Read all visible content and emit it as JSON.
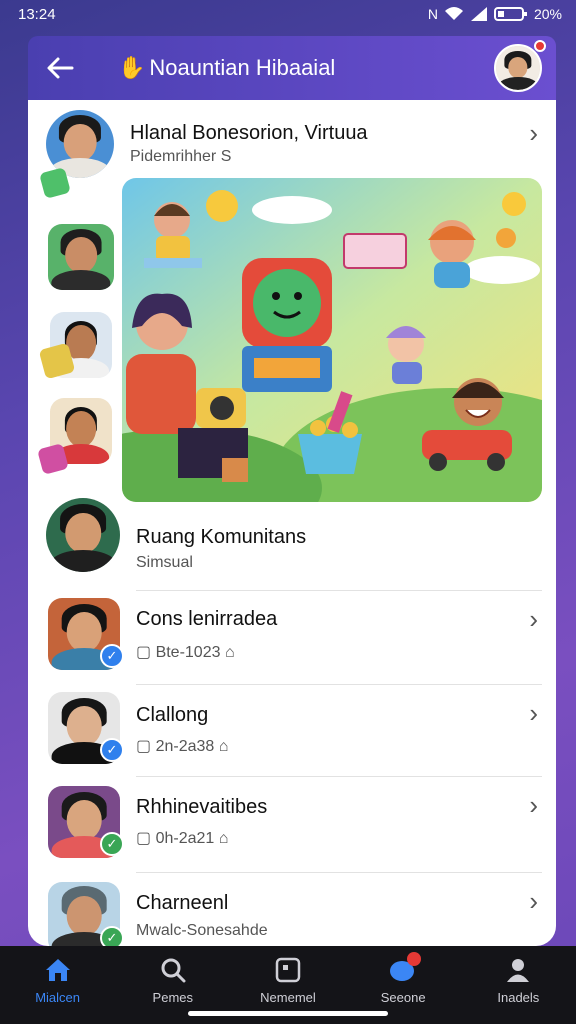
{
  "status_bar": {
    "time": "13:24",
    "indicators": "N",
    "battery": "20%"
  },
  "header": {
    "title": "Noauntian Hibaaial",
    "back_icon": "back-arrow-icon",
    "wave_icon": "wave-hand-icon"
  },
  "featured": {
    "title": "Hlanal Bonesorion, Virtuua",
    "subtitle": "Pidemrihher S"
  },
  "community": {
    "title": "Ruang Komunitans",
    "subtitle": "Simsual"
  },
  "list": [
    {
      "title": "Cons lenirradea",
      "meta": "Bte-1023",
      "badge": "check"
    },
    {
      "title": "Clallong",
      "meta": "2n-2a38",
      "badge": "check"
    },
    {
      "title": "Rhhinevaitibes",
      "meta": "0h-2a21",
      "badge": "check"
    },
    {
      "title": "Charneenl",
      "meta": "Mwalc-Sonesahde",
      "badge": "check"
    }
  ],
  "nav": [
    {
      "label": "Mialcen",
      "icon": "home-icon",
      "active": true
    },
    {
      "label": "Pemes",
      "icon": "search-icon",
      "active": false
    },
    {
      "label": "Nememel",
      "icon": "grid-icon",
      "active": false
    },
    {
      "label": "Seeone",
      "icon": "chat-bubble-icon",
      "active": false
    },
    {
      "label": "Inadels",
      "icon": "profile-icon",
      "active": false
    }
  ],
  "colors": {
    "accent": "#3b86f5",
    "header": "#5a46c0",
    "badge_blue": "#2f80ed",
    "badge_green": "#3aa655"
  }
}
